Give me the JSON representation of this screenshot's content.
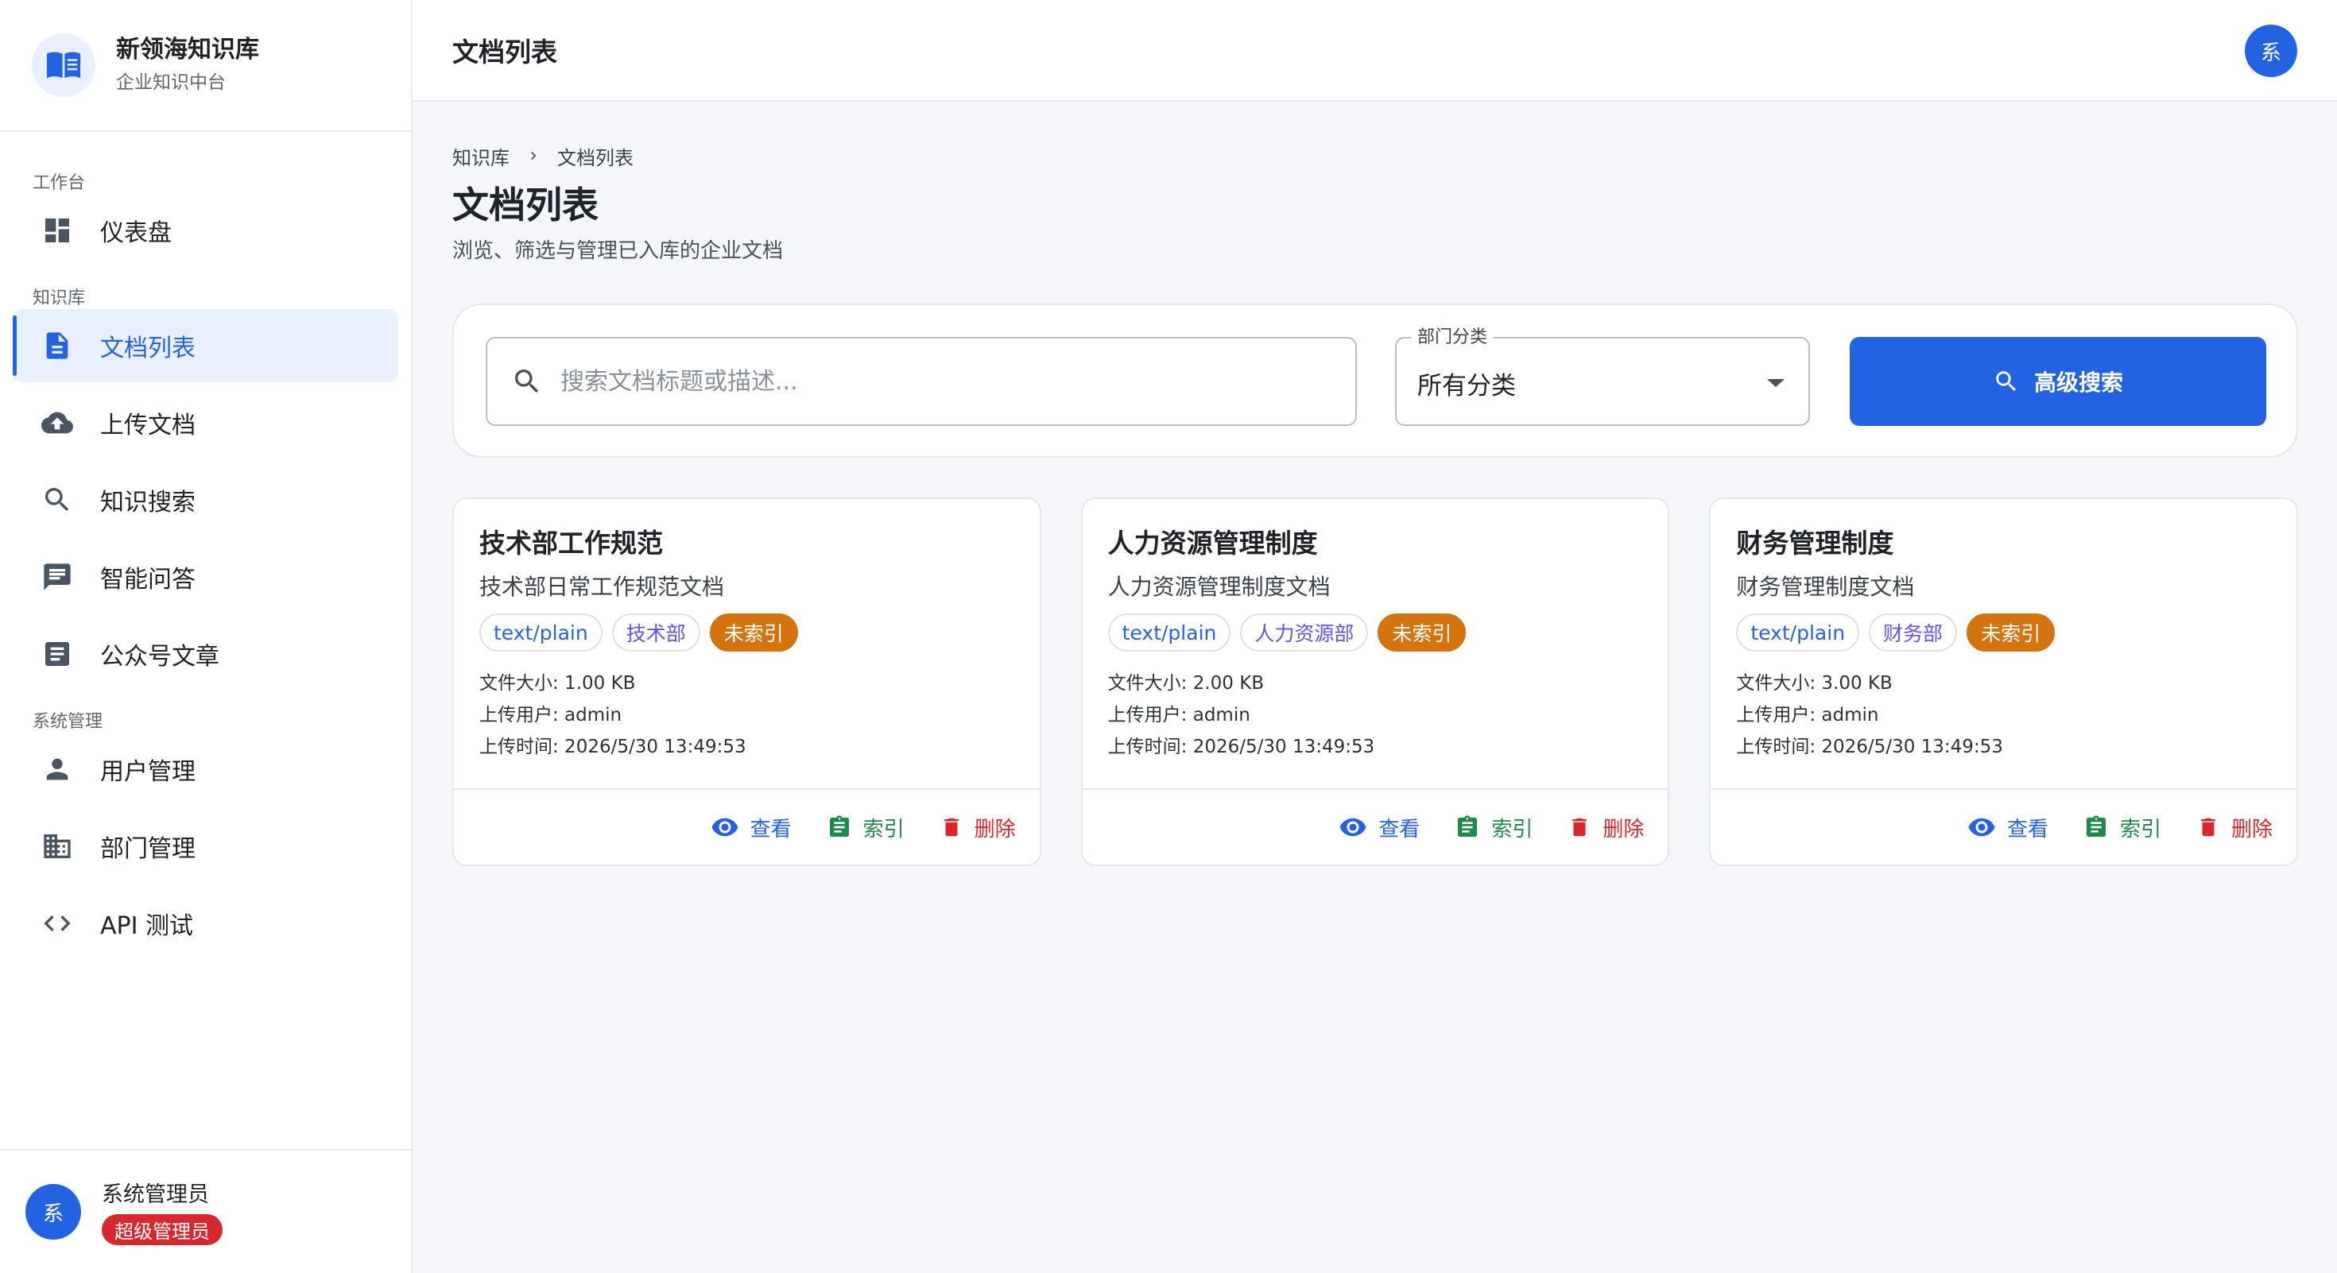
{
  "brand": {
    "title": "新领海知识库",
    "subtitle": "企业知识中台"
  },
  "sidebar": {
    "sections": [
      {
        "label": "工作台"
      },
      {
        "label": "知识库"
      },
      {
        "label": "系统管理"
      }
    ],
    "items": [
      {
        "label": "仪表盘",
        "icon": "dashboard-icon"
      },
      {
        "label": "文档列表",
        "icon": "document-icon",
        "active": true
      },
      {
        "label": "上传文档",
        "icon": "cloud-upload-icon"
      },
      {
        "label": "知识搜索",
        "icon": "search-icon"
      },
      {
        "label": "智能问答",
        "icon": "chat-icon"
      },
      {
        "label": "公众号文章",
        "icon": "article-icon"
      },
      {
        "label": "用户管理",
        "icon": "person-icon"
      },
      {
        "label": "部门管理",
        "icon": "building-icon"
      },
      {
        "label": "API 测试",
        "icon": "code-icon"
      }
    ]
  },
  "user": {
    "avatar": "系",
    "name": "系统管理员",
    "role": "超级管理员"
  },
  "header": {
    "title": "文档列表",
    "avatar": "系"
  },
  "breadcrumb": {
    "root": "知识库",
    "current": "文档列表"
  },
  "page": {
    "title": "文档列表",
    "subtitle": "浏览、筛选与管理已入库的企业文档"
  },
  "filter": {
    "search_placeholder": "搜索文档标题或描述...",
    "search_value": "",
    "category_label": "部门分类",
    "category_value": "所有分类",
    "advanced_search": "高级搜索"
  },
  "colors": {
    "primary": "#2462e4",
    "status_unindexed": "#d4740e",
    "danger": "#d9272e",
    "success": "#1b8a4a"
  },
  "documents": [
    {
      "title": "技术部工作规范",
      "description": "技术部日常工作规范文档",
      "mime": "text/plain",
      "department": "技术部",
      "status": "未索引",
      "size": "文件大小: 1.00 KB",
      "uploader": "上传用户: admin",
      "uploaded_at": "上传时间: 2026/5/30 13:49:53",
      "actions": {
        "view": "查看",
        "index": "索引",
        "delete": "删除"
      }
    },
    {
      "title": "人力资源管理制度",
      "description": "人力资源管理制度文档",
      "mime": "text/plain",
      "department": "人力资源部",
      "status": "未索引",
      "size": "文件大小: 2.00 KB",
      "uploader": "上传用户: admin",
      "uploaded_at": "上传时间: 2026/5/30 13:49:53",
      "actions": {
        "view": "查看",
        "index": "索引",
        "delete": "删除"
      }
    },
    {
      "title": "财务管理制度",
      "description": "财务管理制度文档",
      "mime": "text/plain",
      "department": "财务部",
      "status": "未索引",
      "size": "文件大小: 3.00 KB",
      "uploader": "上传用户: admin",
      "uploaded_at": "上传时间: 2026/5/30 13:49:53",
      "actions": {
        "view": "查看",
        "index": "索引",
        "delete": "删除"
      }
    }
  ]
}
